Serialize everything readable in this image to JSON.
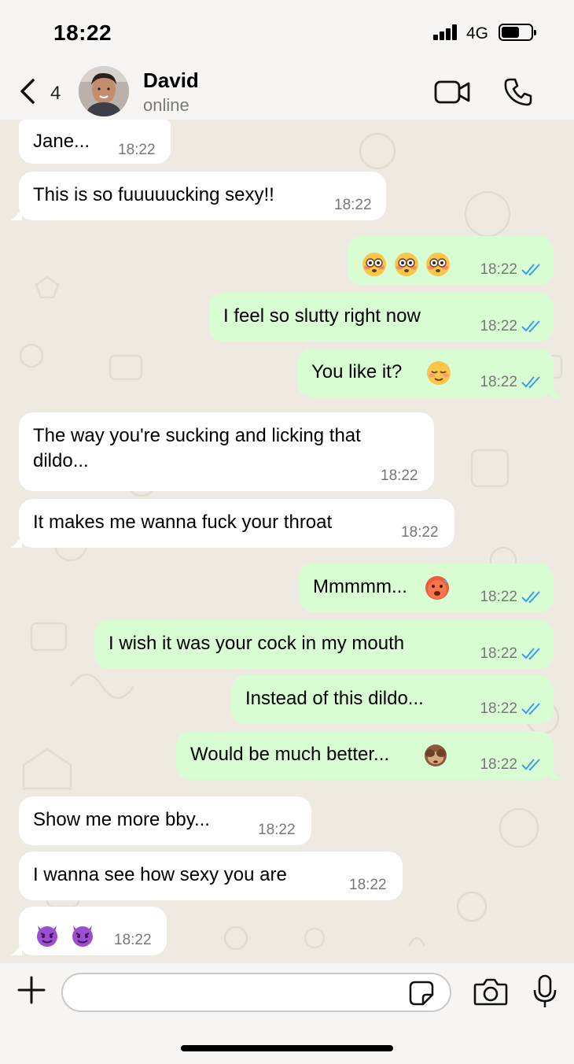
{
  "status_bar": {
    "time": "18:22",
    "network": "4G"
  },
  "header": {
    "back_count": "4",
    "name": "David",
    "status": "online"
  },
  "messages": [
    {
      "text": "Jane...",
      "time": "18:22"
    },
    {
      "text": "This is so fuuuuucking sexy!!",
      "time": "18:22"
    },
    {
      "text": "",
      "time": "18:22",
      "emoji": [
        "flushed-face",
        "flushed-face",
        "flushed-face"
      ]
    },
    {
      "text": "I feel so slutty right now",
      "time": "18:22"
    },
    {
      "text": "You like it?",
      "time": "18:22",
      "emoji": [
        "relieved-face"
      ]
    },
    {
      "text": "The way you're sucking and licking that",
      "text2": "dildo...",
      "time": "18:22"
    },
    {
      "text": "It makes me wanna fuck your throat",
      "time": "18:22"
    },
    {
      "text": "Mmmmm...",
      "time": "18:22",
      "emoji": [
        "hot-face"
      ]
    },
    {
      "text": "I wish it was your cock in my mouth",
      "time": "18:22"
    },
    {
      "text": "Instead of this dildo...",
      "time": "18:22"
    },
    {
      "text": "Would be much better...",
      "time": "18:22",
      "emoji": [
        "see-no-evil-monkey"
      ]
    },
    {
      "text": "Show me more bby...",
      "time": "18:22"
    },
    {
      "text": "I wanna see how sexy you are",
      "time": "18:22"
    },
    {
      "text": "",
      "time": "18:22",
      "emoji": [
        "smiling-face-with-horns",
        "smiling-face-with-horns"
      ]
    }
  ],
  "input": {
    "value": "",
    "placeholder": ""
  },
  "colors": {
    "incoming": "#ffffff",
    "outgoing": "#d9fdd3",
    "read_ticks": "#3b9bf0",
    "background": "#eeeae2"
  }
}
